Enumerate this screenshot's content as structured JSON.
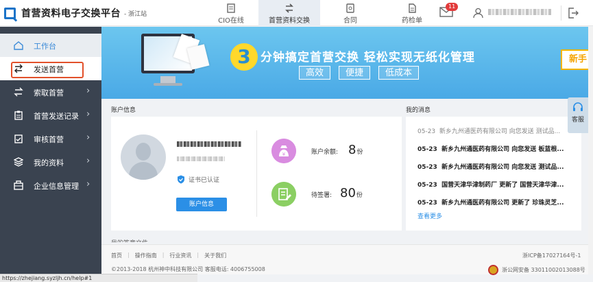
{
  "header": {
    "title": "首营资料电子交换平台",
    "station": "- 浙江站",
    "nav": [
      {
        "label": "CIO在线",
        "icon": "document-icon"
      },
      {
        "label": "首营资料交换",
        "icon": "exchange-icon"
      },
      {
        "label": "合同",
        "icon": "contract-icon"
      },
      {
        "label": "药检单",
        "icon": "drug-report-icon"
      }
    ],
    "mail_badge": "11",
    "colors": {
      "accent": "#2b8fe6",
      "sidebar": "#3a4350",
      "badge": "#e23b3b"
    }
  },
  "sidebar": {
    "items": [
      {
        "label": "工作台",
        "icon": "home-icon",
        "has_arrow": false
      },
      {
        "label": "发送首营",
        "icon": "send-icon",
        "has_arrow": false
      },
      {
        "label": "索取首营",
        "icon": "request-icon",
        "has_arrow": true
      },
      {
        "label": "首营发送记录",
        "icon": "record-icon",
        "has_arrow": true
      },
      {
        "label": "审核首营",
        "icon": "audit-icon",
        "has_arrow": true
      },
      {
        "label": "我的资料",
        "icon": "layers-icon",
        "has_arrow": true
      },
      {
        "label": "企业信息管理",
        "icon": "company-icon",
        "has_arrow": true
      }
    ],
    "arrow": "›"
  },
  "banner": {
    "number": "3",
    "slogan": "分钟搞定首营交换    轻松实现无纸化管理",
    "tags": [
      "高效",
      "便捷",
      "低成本"
    ],
    "new_button": "新手"
  },
  "account": {
    "section_title": "账户信息",
    "cert_status": "证书已认证",
    "button": "账户信息",
    "balance_label": "账户余额:",
    "balance_value": "8",
    "balance_unit": "份",
    "pending_label": "待签署:",
    "pending_value": "80",
    "pending_unit": "份"
  },
  "messages": {
    "section_title": "我的消息",
    "items": [
      {
        "date": "05-23",
        "text": "新乡九州通医药有限公司 向您发送  测试品...",
        "read": true
      },
      {
        "date": "05-23",
        "text": "新乡九州通医药有限公司 向您发送  板蓝根...",
        "read": false
      },
      {
        "date": "05-23",
        "text": "新乡九州通医药有限公司 向您发送  测试品...",
        "read": false
      },
      {
        "date": "05-23",
        "text": "国营天津华津制药厂 更新了  国营天津华津...",
        "read": false
      },
      {
        "date": "05-23",
        "text": "新乡九州通医药有限公司 更新了  珍珠灵芝...",
        "read": false
      }
    ],
    "more": "查看更多"
  },
  "kefu": {
    "label": "客服"
  },
  "partial_section": "我的签章文件",
  "footer": {
    "links": [
      "首页",
      "操作指南",
      "行业资讯",
      "关于我们"
    ],
    "copyright": "©2013-2018  杭州神中科技有限公司   客服电话: 4006755008",
    "icp": "浙ICP备17027164号-1",
    "police": "浙公网安备 33011002013088号"
  },
  "status_url": "https://zhejiang.syzljh.cn/help#1"
}
